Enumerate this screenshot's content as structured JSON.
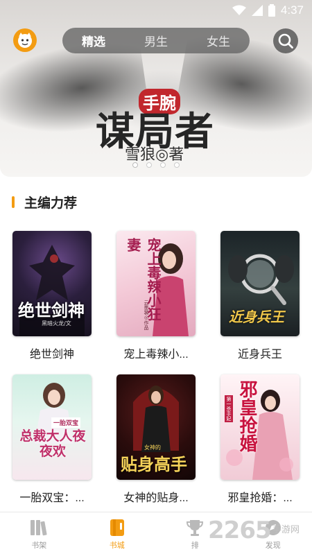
{
  "status_bar": {
    "time": "4:37"
  },
  "header": {
    "tabs": [
      {
        "label": "精选",
        "active": true
      },
      {
        "label": "男生",
        "active": false
      },
      {
        "label": "女生",
        "active": false
      }
    ]
  },
  "banner": {
    "prefix": "手腕",
    "title": "谋局者",
    "author": "雪狼◎著",
    "page_count": 4,
    "active_index": 0
  },
  "section": {
    "title": "主编力荐"
  },
  "books": [
    {
      "title": "绝世剑神",
      "cover_text": "绝世剑神",
      "cover_sub": "黑暗火龙/文"
    },
    {
      "title": "宠上毒辣小...",
      "cover_text": "宠上毒辣小狂妻",
      "cover_sub": "云墨裳◎作品"
    },
    {
      "title": "近身兵王",
      "cover_text": "近身兵王",
      "cover_sub": ""
    },
    {
      "title": "一胎双宝：...",
      "cover_text": "总裁大人夜夜欢",
      "cover_sub": "一胎双宝"
    },
    {
      "title": "女神的贴身...",
      "cover_text": "贴身高手",
      "cover_sub": "女神的"
    },
    {
      "title": "邪皇抢婚：...",
      "cover_text": "邪皇抢婚",
      "cover_sub": "第一杀手妃"
    }
  ],
  "bottom_nav": [
    {
      "label": "书架",
      "icon": "bookshelf-icon",
      "active": false
    },
    {
      "label": "书城",
      "icon": "bookstore-icon",
      "active": true
    },
    {
      "label": "排",
      "icon": "trophy-icon",
      "active": false
    },
    {
      "label": "发现",
      "icon": "discover-icon",
      "active": false
    }
  ],
  "watermark": {
    "text": "2265",
    "sub": "手游网"
  },
  "colors": {
    "accent": "#f39c12",
    "text": "#222222",
    "nav_inactive": "#9a9a9a"
  }
}
